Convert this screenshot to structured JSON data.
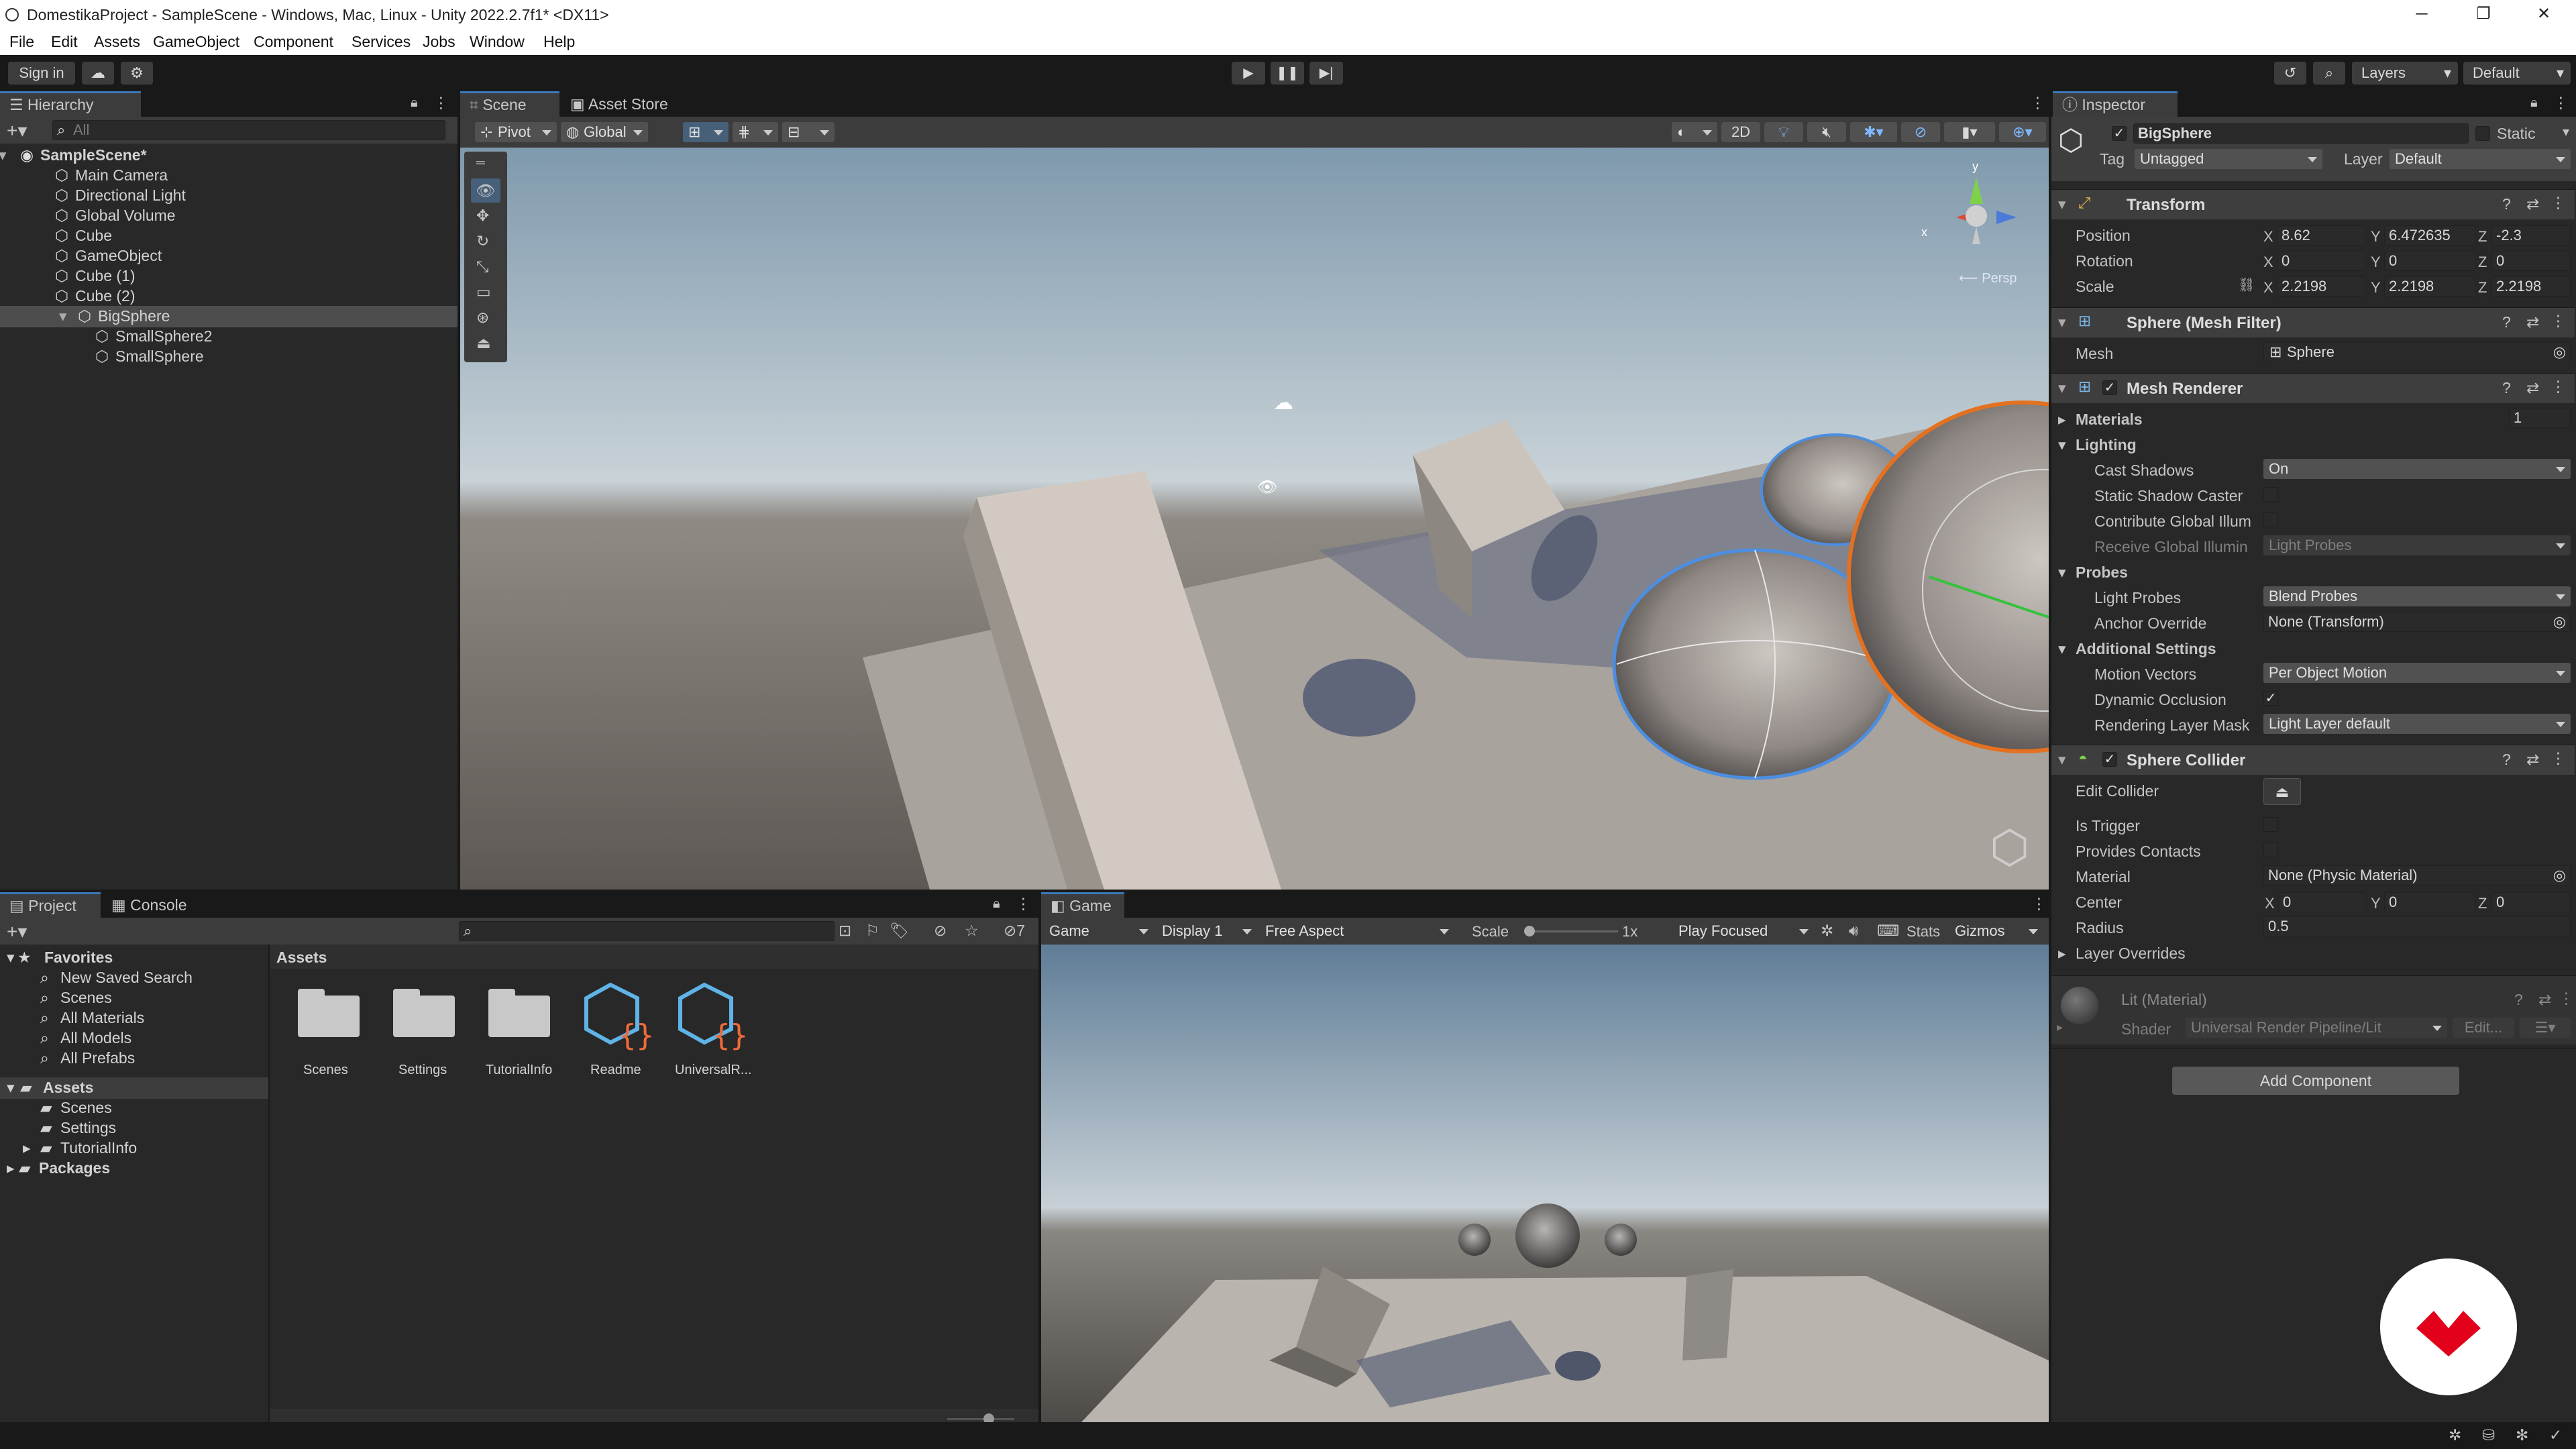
{
  "window": {
    "title": "DomestikaProject - SampleScene - Windows, Mac, Linux - Unity 2022.2.7f1* <DX11>",
    "minimize": "─",
    "maximize": "❐",
    "close": "✕"
  },
  "menu": [
    "File",
    "Edit",
    "Assets",
    "GameObject",
    "Component",
    "Services",
    "Jobs",
    "Window",
    "Help"
  ],
  "toolbar": {
    "sign_in": "Sign in",
    "layers": "Layers",
    "layout": "Default"
  },
  "hierarchy": {
    "tab": "Hierarchy",
    "search_placeholder": "All",
    "scene": "SampleScene*",
    "items": [
      "Main Camera",
      "Directional Light",
      "Global Volume",
      "Cube",
      "GameObject",
      "Cube (1)",
      "Cube (2)",
      "BigSphere"
    ],
    "children": [
      "SmallSphere2",
      "SmallSphere"
    ]
  },
  "scene_view": {
    "tabs": [
      "Scene",
      "Asset Store"
    ],
    "pivot": "Pivot",
    "global": "Global",
    "mode_2d": "2D",
    "persp": "Persp",
    "gizmo_y": "y",
    "gizmo_x": "x"
  },
  "project": {
    "tabs": [
      "Project",
      "Console"
    ],
    "count_badge": "7",
    "favorites_label": "Favorites",
    "favorites": [
      "New Saved Search",
      "Scenes",
      "All Materials",
      "All Models",
      "All Prefabs"
    ],
    "assets_label": "Assets",
    "assets_children": [
      "Scenes",
      "Settings",
      "TutorialInfo"
    ],
    "packages": "Packages",
    "breadcrumb": "Assets",
    "grid_items": [
      "Scenes",
      "Settings",
      "TutorialInfo",
      "Readme",
      "UniversalR..."
    ]
  },
  "game_view": {
    "tab": "Game",
    "mode": "Game",
    "display": "Display 1",
    "aspect": "Free Aspect",
    "scale_label": "Scale",
    "scale_value": "1x",
    "play_mode": "Play Focused",
    "stats": "Stats",
    "gizmos": "Gizmos"
  },
  "inspector": {
    "tab": "Inspector",
    "object_name": "BigSphere",
    "static_label": "Static",
    "tag_label": "Tag",
    "tag_value": "Untagged",
    "layer_label": "Layer",
    "layer_value": "Default",
    "transform": {
      "title": "Transform",
      "position_label": "Position",
      "rotation_label": "Rotation",
      "scale_label": "Scale",
      "position": [
        "8.62",
        "6.472635",
        "-2.3"
      ],
      "rotation": [
        "0",
        "0",
        "0"
      ],
      "scale": [
        "2.2198",
        "2.2198",
        "2.2198"
      ]
    },
    "mesh_filter": {
      "title": "Sphere (Mesh Filter)",
      "mesh_label": "Mesh",
      "mesh_value": "Sphere"
    },
    "mesh_renderer": {
      "title": "Mesh Renderer",
      "materials_label": "Materials",
      "materials_count": "1",
      "lighting_label": "Lighting",
      "cast_shadows_label": "Cast Shadows",
      "cast_shadows_value": "On",
      "static_shadow_label": "Static Shadow Caster",
      "contribute_gi_label": "Contribute Global Illum",
      "receive_gi_label": "Receive Global Illumin",
      "receive_gi_value": "Light Probes",
      "probes_label": "Probes",
      "light_probes_label": "Light Probes",
      "light_probes_value": "Blend Probes",
      "anchor_label": "Anchor Override",
      "anchor_value": "None (Transform)",
      "additional_label": "Additional Settings",
      "motion_vectors_label": "Motion Vectors",
      "motion_vectors_value": "Per Object Motion",
      "dynamic_occlusion_label": "Dynamic Occlusion",
      "rendering_layer_label": "Rendering Layer Mask",
      "rendering_layer_value": "Light Layer default"
    },
    "sphere_collider": {
      "title": "Sphere Collider",
      "edit_collider_label": "Edit Collider",
      "is_trigger_label": "Is Trigger",
      "provides_contacts_label": "Provides Contacts",
      "material_label": "Material",
      "material_value": "None (Physic Material)",
      "center_label": "Center",
      "center": [
        "0",
        "0",
        "0"
      ],
      "radius_label": "Radius",
      "radius_value": "0.5",
      "layer_overrides_label": "Layer Overrides"
    },
    "material": {
      "title": "Lit (Material)",
      "shader_label": "Shader",
      "shader_value": "Universal Render Pipeline/Lit",
      "edit_button": "Edit..."
    },
    "add_component": "Add Component",
    "axis_labels": [
      "X",
      "Y",
      "Z"
    ]
  },
  "colors": {
    "accent": "#3a79bb",
    "selection": "#2c5d87",
    "panel": "#282828",
    "brand": "#e2001a"
  }
}
